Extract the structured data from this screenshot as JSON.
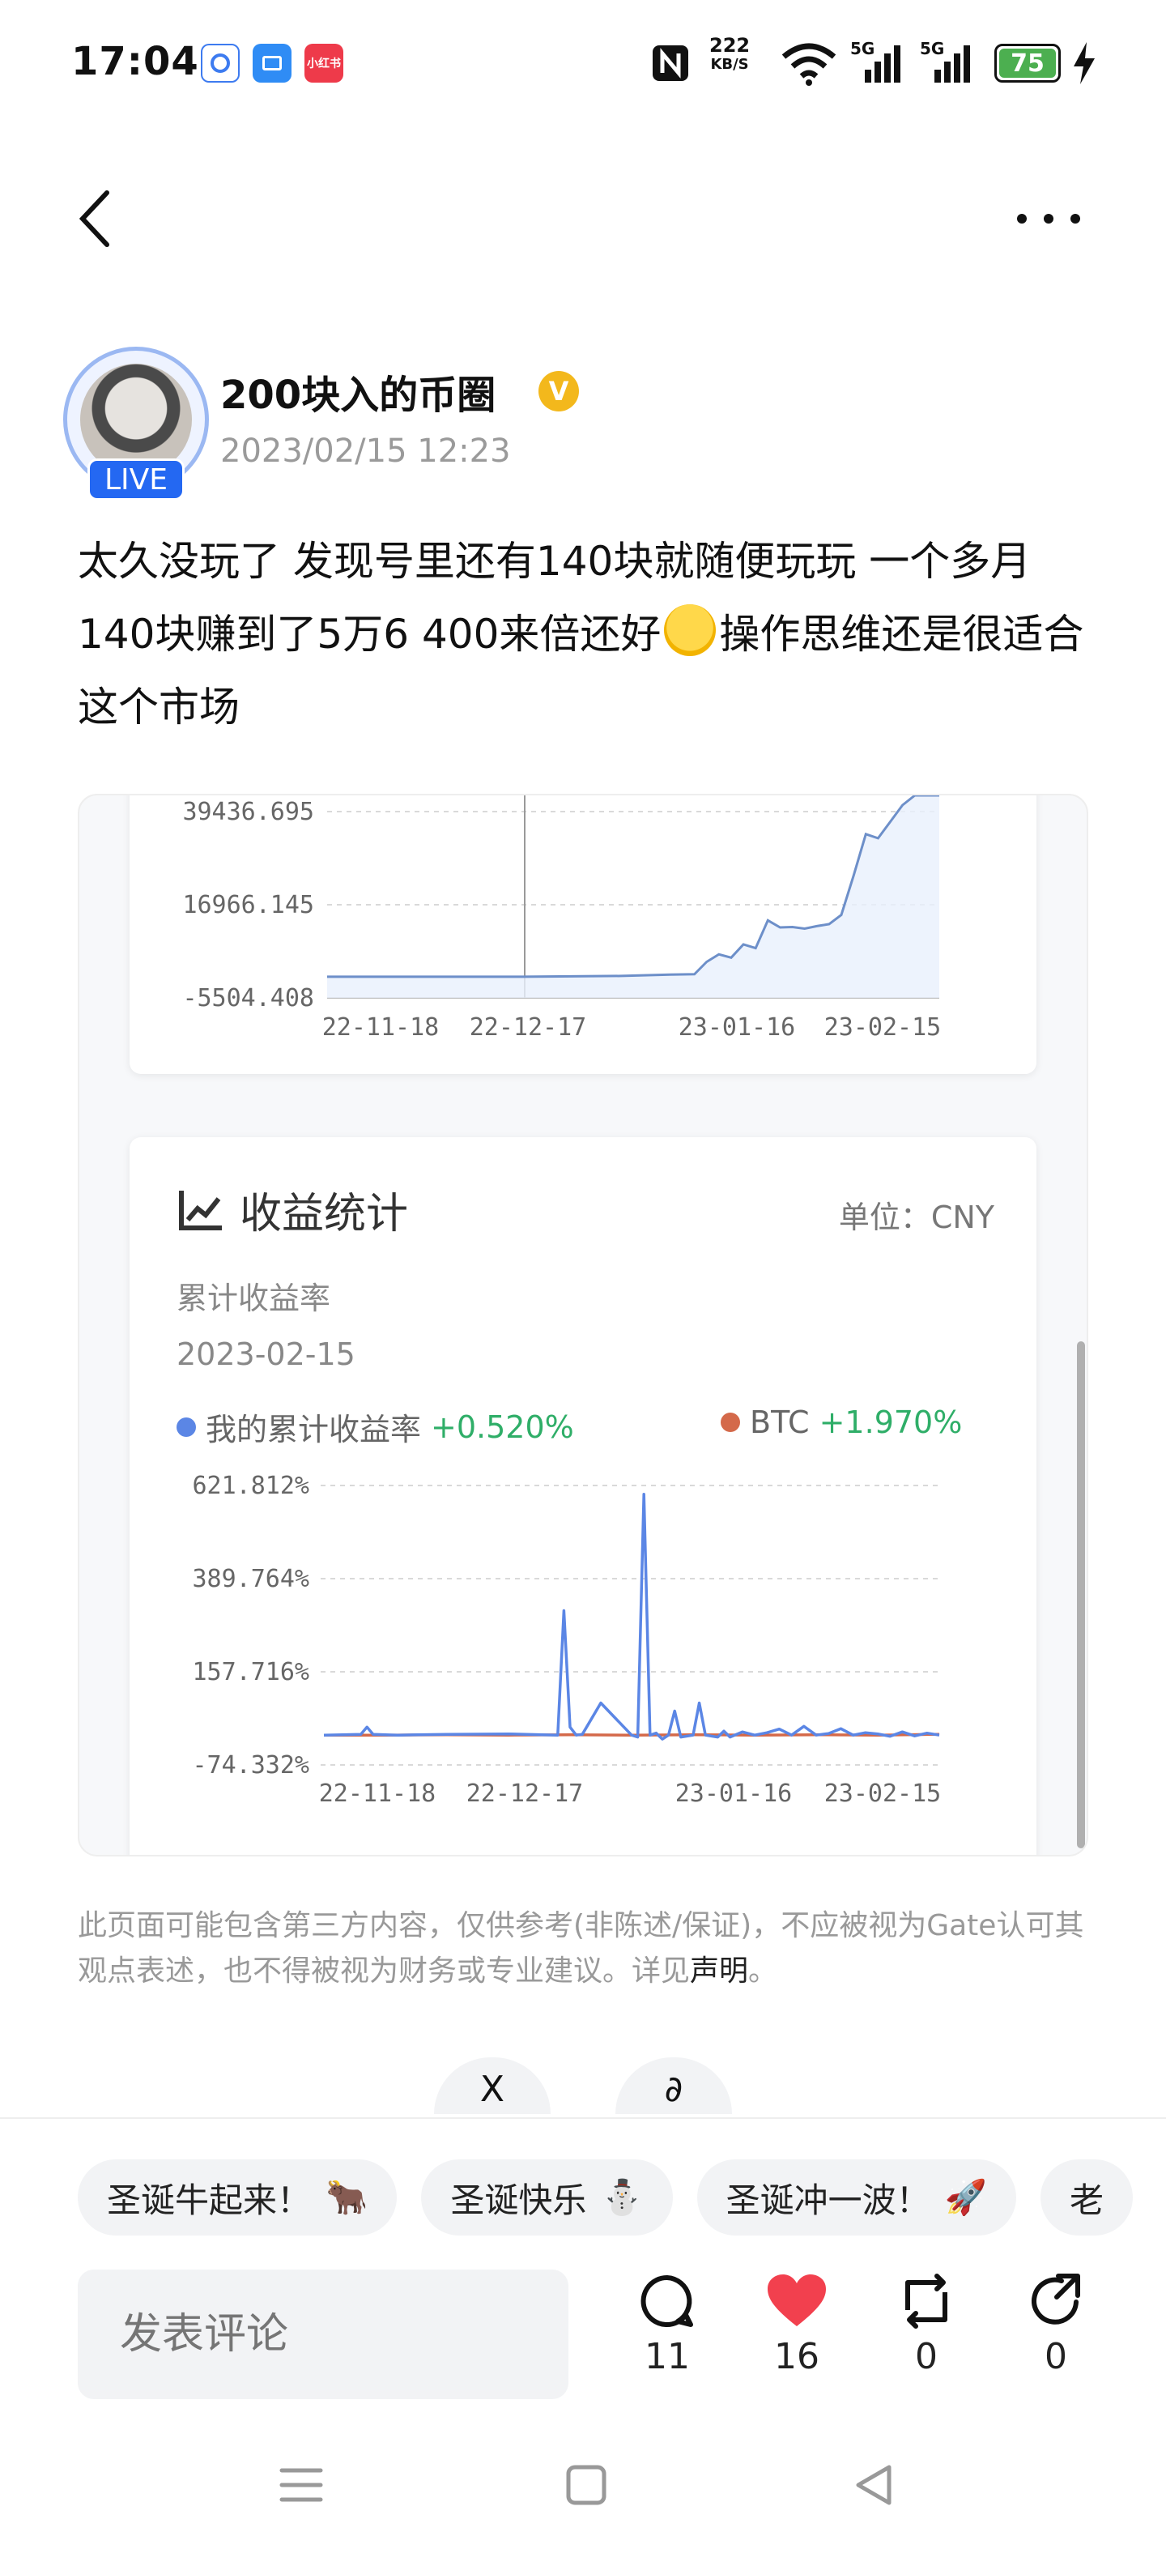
{
  "status_bar": {
    "time": "17:04",
    "net_speed": "222",
    "net_unit": "KB/S",
    "signal1": "5G",
    "signal2": "5G",
    "battery": "75",
    "apps": [
      {
        "name": "app-icon",
        "color": "#3d7bf0"
      },
      {
        "name": "app-icon",
        "color": "#2f8cf5"
      },
      {
        "name": "xiaohongshu-icon",
        "label": "小红书",
        "color": "#ee3a4a"
      }
    ]
  },
  "author": {
    "name": "200块入的币圈",
    "time": "2023/02/15 12:23",
    "live": "LIVE"
  },
  "post": {
    "text_before": "太久没玩了 发现号里还有140块就随便玩玩 一个多月140块赚到了5万6 400来倍还好",
    "text_after": "操作思维还是很适合这个市场"
  },
  "chart_top": {
    "y_ticks": [
      "39436.695",
      "16966.145",
      "-5504.408"
    ],
    "x_ticks": [
      "22-11-18",
      "22-12-17",
      "23-01-16",
      "23-02-15"
    ]
  },
  "stats_card": {
    "title": "收益统计",
    "unit": "单位：CNY",
    "sub1": "累计收益率",
    "date": "2023-02-15",
    "legend_mine": "我的累计收益率",
    "legend_mine_pct": "+0.520%",
    "legend_btc": "BTC",
    "legend_btc_pct": "+1.970%",
    "colors": {
      "mine": "#5b86e5",
      "btc": "#d4694a",
      "positive": "#2fae68"
    }
  },
  "chart_data": [
    {
      "type": "area",
      "y_ticks": [
        39436.695,
        16966.145,
        -5504.408
      ],
      "x_ticks": [
        "22-11-18",
        "22-12-17",
        "23-01-16",
        "23-02-15"
      ],
      "series": [
        {
          "x": [
            0,
            8,
            16,
            24,
            32,
            40,
            48,
            56,
            60,
            62,
            64,
            66,
            68,
            70,
            72,
            74,
            76,
            78,
            80,
            82,
            84,
            86,
            88,
            90,
            92,
            94,
            96,
            98,
            100
          ],
          "values": [
            -400,
            -400,
            -400,
            -400,
            -400,
            -300,
            -200,
            100,
            200,
            3200,
            5000,
            4200,
            7400,
            6500,
            13200,
            11500,
            11600,
            11200,
            11800,
            12300,
            14500,
            24000,
            34000,
            33000,
            37000,
            41000,
            45000,
            48000,
            50000
          ]
        }
      ]
    },
    {
      "type": "line",
      "y_ticks": [
        "621.812%",
        "389.764%",
        "157.716%",
        "-74.332%"
      ],
      "ylim": [
        -74.332,
        621.812
      ],
      "x_ticks": [
        "22-11-18",
        "22-12-17",
        "23-01-16",
        "23-02-15"
      ],
      "series": [
        {
          "name": "我的累计收益率",
          "color": "#5b86e5",
          "x": [
            0,
            6,
            7,
            8,
            12,
            20,
            30,
            38,
            39,
            40,
            41,
            42,
            45,
            50,
            51,
            52,
            53,
            54,
            55,
            56,
            57,
            58,
            60,
            61,
            62,
            64,
            65,
            66,
            68,
            70,
            72,
            74,
            76,
            78,
            80,
            82,
            84,
            86,
            88,
            90,
            92,
            94,
            96,
            98,
            100
          ],
          "values": [
            0,
            2,
            20,
            2,
            0,
            2,
            3,
            0,
            310,
            20,
            0,
            2,
            80,
            0,
            -5,
            600,
            0,
            5,
            -10,
            0,
            60,
            -5,
            0,
            80,
            0,
            -5,
            10,
            -5,
            8,
            0,
            6,
            15,
            0,
            22,
            0,
            4,
            16,
            0,
            6,
            3,
            -3,
            8,
            -2,
            5,
            0
          ]
        },
        {
          "name": "BTC",
          "color": "#d4694a",
          "x": [
            0,
            10,
            20,
            30,
            40,
            50,
            60,
            70,
            80,
            90,
            100
          ],
          "values": [
            0,
            0,
            1,
            0,
            1,
            0,
            1,
            0,
            1,
            0,
            2
          ]
        }
      ]
    }
  ],
  "disclaimer": {
    "text": "此页面可能包含第三方内容，仅供参考(非陈述/保证)，不应被视为Gate认可其观点表述，也不得被视为财务或专业建议。详见",
    "link": "声明",
    "end": "。"
  },
  "share": {
    "x": "X",
    "link": "∂"
  },
  "chips": [
    {
      "label": "圣诞牛起来！",
      "emoji": "🐂"
    },
    {
      "label": "圣诞快乐",
      "emoji": "⛄"
    },
    {
      "label": "圣诞冲一波！",
      "emoji": "🚀"
    },
    {
      "label": "老",
      "emoji": ""
    }
  ],
  "comment": {
    "placeholder": "发表评论"
  },
  "actions": {
    "comments": "11",
    "likes": "16",
    "reposts": "0",
    "shares": "0"
  }
}
